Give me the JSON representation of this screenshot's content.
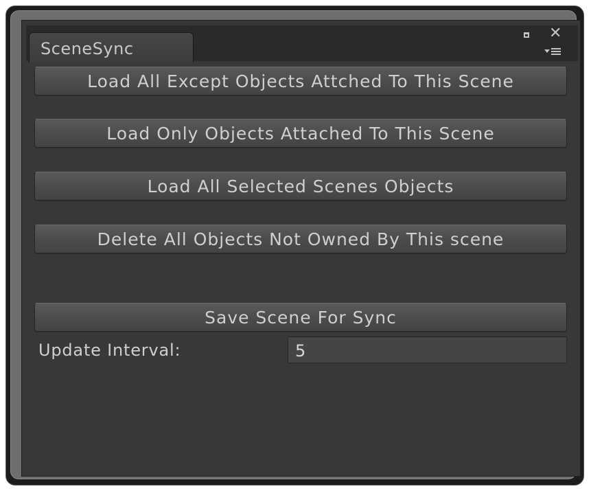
{
  "window": {
    "tab_title": "SceneSync"
  },
  "icons": {
    "maximize": "maximize-icon",
    "close": "close-icon",
    "menu": "dropdown-menu-icon",
    "close_glyph": "✕"
  },
  "buttons": {
    "load_all_except": "Load All Except Objects Attched To This Scene",
    "load_only": "Load Only Objects Attached To This Scene",
    "load_selected": "Load All Selected Scenes Objects",
    "delete_not_owned": "Delete All Objects Not Owned By This scene",
    "save_scene": "Save Scene For Sync"
  },
  "settings": {
    "update_interval_label": "Update Interval:",
    "update_interval_value": "5"
  },
  "colors": {
    "panel_bg": "#383838",
    "button_bg": "#4b4b4b",
    "text": "#cfcfcf"
  }
}
